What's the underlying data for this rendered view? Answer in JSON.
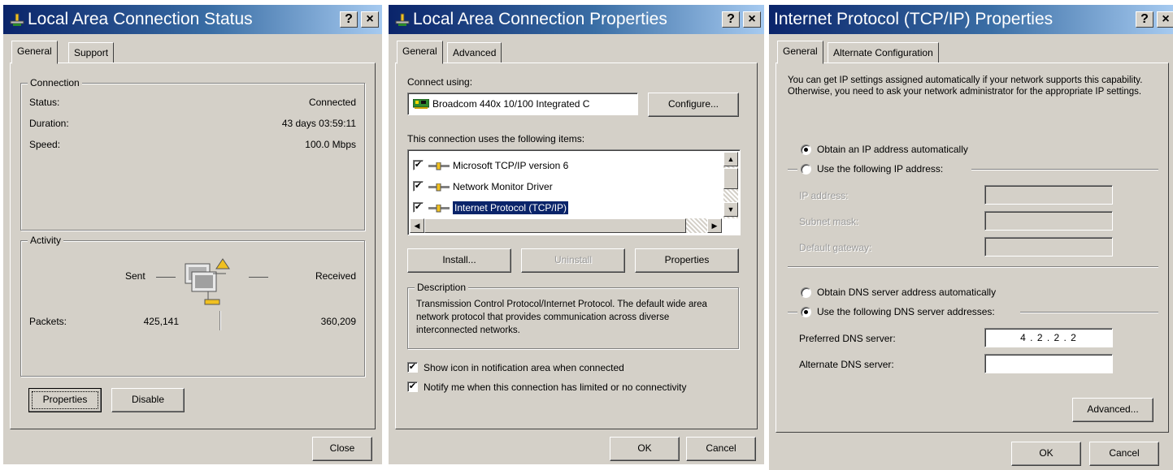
{
  "status_dialog": {
    "title": "Local Area Connection Status",
    "help_glyph": "?",
    "close_glyph": "×",
    "tabs": [
      "General",
      "Support"
    ],
    "connection_group": "Connection",
    "status_label": "Status:",
    "status_value": "Connected",
    "duration_label": "Duration:",
    "duration_value": "43 days 03:59:11",
    "speed_label": "Speed:",
    "speed_value": "100.0 Mbps",
    "activity_group": "Activity",
    "sent_label": "Sent",
    "received_label": "Received",
    "packets_label": "Packets:",
    "packets_sent": "425,141",
    "packets_received": "360,209",
    "properties_button": "Properties",
    "disable_button": "Disable",
    "close_button": "Close"
  },
  "properties_dialog": {
    "title": "Local Area Connection Properties",
    "help_glyph": "?",
    "close_glyph": "×",
    "tabs": [
      "General",
      "Advanced"
    ],
    "connect_using_label": "Connect using:",
    "adapter_name": "Broadcom 440x 10/100 Integrated C",
    "configure_button": "Configure...",
    "items_label": "This connection uses the following items:",
    "items": [
      {
        "label": "Microsoft TCP/IP version 6",
        "checked": true
      },
      {
        "label": "Network Monitor Driver",
        "checked": true
      },
      {
        "label": "Internet Protocol (TCP/IP)",
        "checked": true,
        "selected": true
      }
    ],
    "install_button": "Install...",
    "uninstall_button": "Uninstall",
    "properties_button": "Properties",
    "description_group": "Description",
    "description_text": "Transmission Control Protocol/Internet Protocol. The default wide area network protocol that provides communication across diverse interconnected networks.",
    "show_icon_label": "Show icon in notification area when connected",
    "notify_label": "Notify me when this connection has limited or no connectivity",
    "check_mark": "✔",
    "ok_button": "OK",
    "cancel_button": "Cancel"
  },
  "tcpip_dialog": {
    "title": "Internet Protocol (TCP/IP) Properties",
    "help_glyph": "?",
    "close_glyph": "×",
    "tabs": [
      "General",
      "Alternate Configuration"
    ],
    "intro_text": "You can get IP settings assigned automatically if your network supports this capability. Otherwise, you need to ask your network administrator for the appropriate IP settings.",
    "obtain_ip_auto": "Obtain an IP address automatically",
    "use_following_ip": "Use the following IP address:",
    "ip_address_label": "IP address:",
    "subnet_mask_label": "Subnet mask:",
    "default_gateway_label": "Default gateway:",
    "obtain_dns_auto": "Obtain DNS server address automatically",
    "use_following_dns": "Use the following DNS server addresses:",
    "preferred_dns_label": "Preferred DNS server:",
    "preferred_dns_value": "4 . 2 . 2 . 2",
    "alternate_dns_label": "Alternate DNS server:",
    "alternate_dns_value": ".     .     .",
    "advanced_button": "Advanced...",
    "ok_button": "OK",
    "cancel_button": "Cancel"
  }
}
